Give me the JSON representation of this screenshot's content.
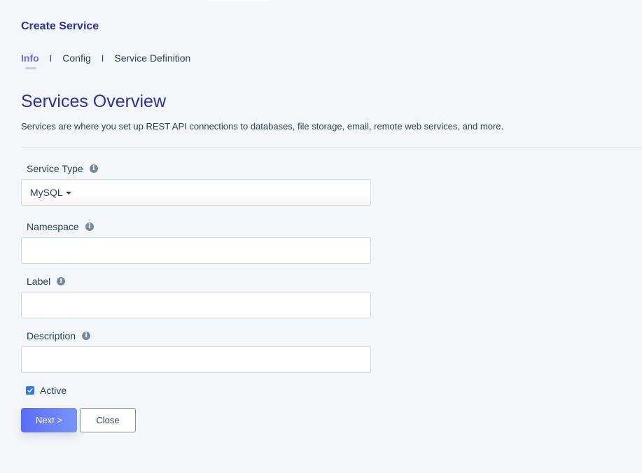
{
  "header": {
    "title": "Create Service"
  },
  "tabs": [
    {
      "label": "Info",
      "active": true
    },
    {
      "label": "Config",
      "active": false
    },
    {
      "label": "Service Definition",
      "active": false
    }
  ],
  "tab_separator": "I",
  "overview": {
    "heading": "Services Overview",
    "description": "Services are where you set up REST API connections to databases, file storage, email, remote web services, and more."
  },
  "form": {
    "service_type": {
      "label": "Service Type",
      "value": "MySQL",
      "icon": "info-icon"
    },
    "namespace": {
      "label": "Namespace",
      "value": "",
      "placeholder": "",
      "icon": "info-icon"
    },
    "label": {
      "label": "Label",
      "value": "",
      "placeholder": "",
      "icon": "info-icon"
    },
    "description": {
      "label": "Description",
      "value": "",
      "placeholder": "",
      "icon": "info-icon"
    },
    "active": {
      "label": "Active",
      "checked": true
    }
  },
  "info_glyph": "i",
  "buttons": {
    "next": "Next >",
    "close": "Close"
  },
  "colors": {
    "accent": "#2f2fa0",
    "tab_active": "#6a6ae6",
    "checkbox": "#2f76e8",
    "button_gradient_start": "#5b6cf7",
    "button_gradient_end": "#7696fb"
  }
}
